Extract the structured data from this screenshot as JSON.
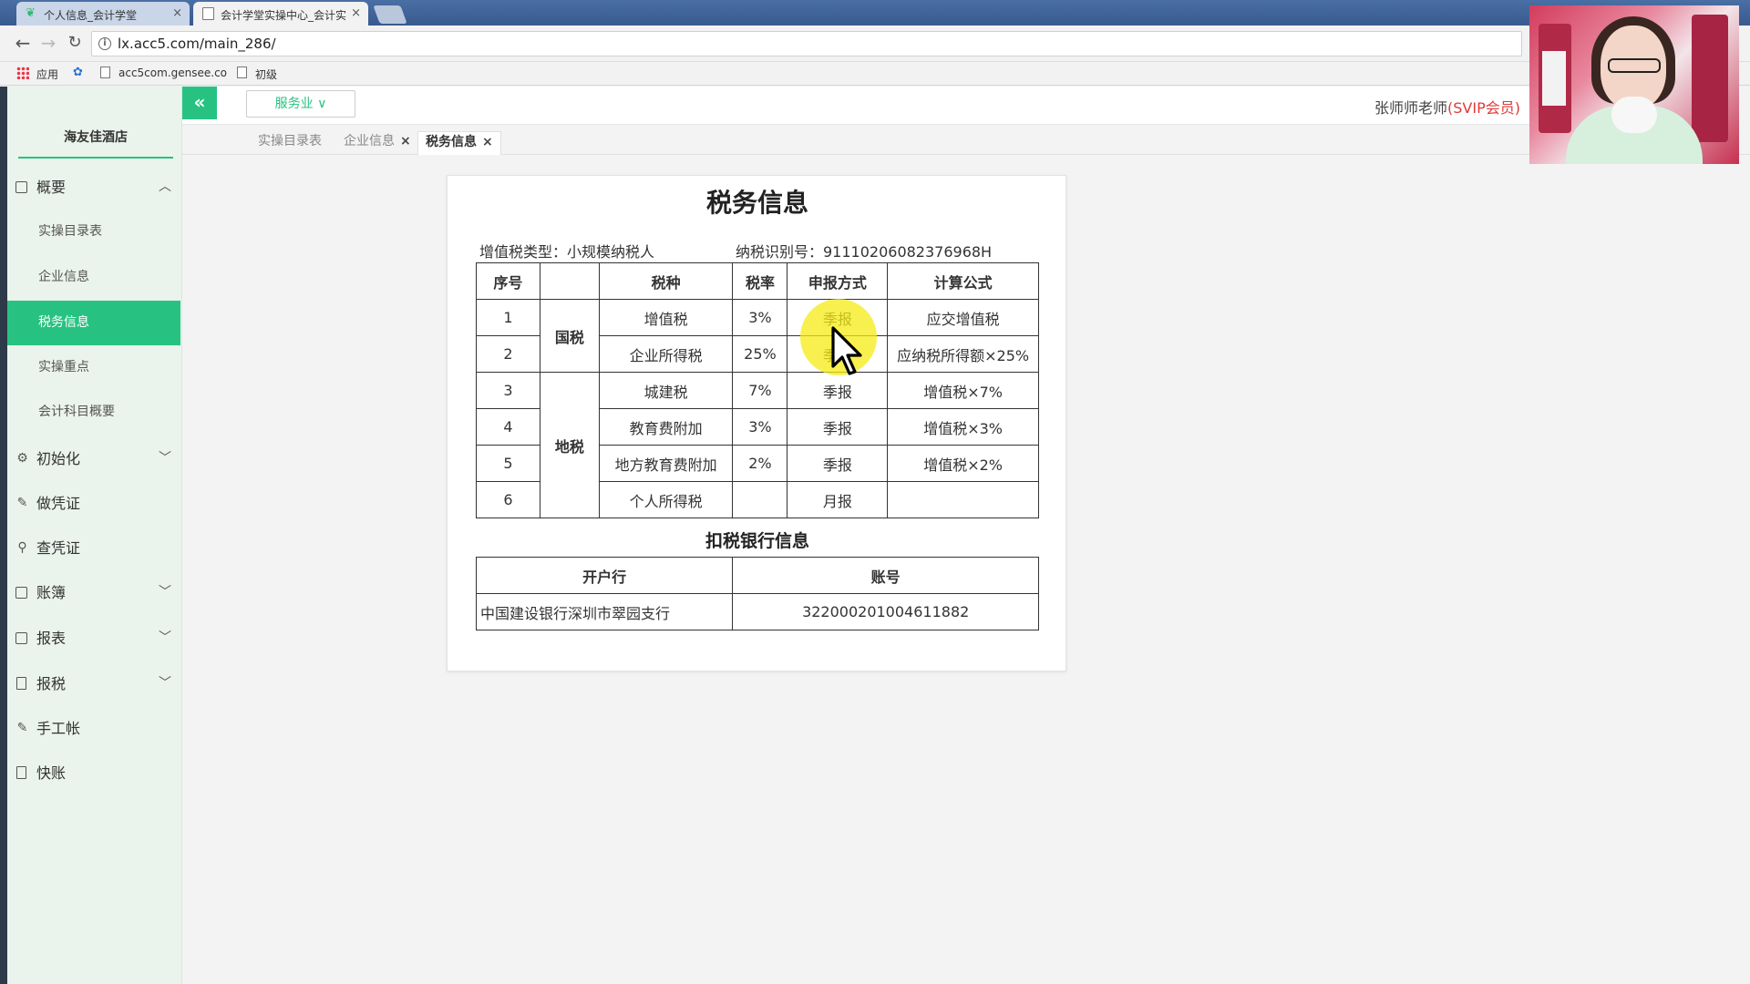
{
  "browser": {
    "tabs": [
      {
        "title": "个人信息_会计学堂",
        "close": "×"
      },
      {
        "title": "会计学堂实操中心_会计实",
        "close": "×"
      }
    ],
    "url": "lx.acc5.com/main_286/",
    "bookmarks": [
      {
        "label": "应用"
      },
      {
        "label": "acc5com.gensee.co"
      },
      {
        "label": "初级"
      }
    ]
  },
  "sidebar": {
    "company": "海友佳酒店",
    "overview": {
      "label": "概要",
      "icon": "grid-icon"
    },
    "sub_items": [
      {
        "label": "实操目录表"
      },
      {
        "label": "企业信息"
      },
      {
        "label": "税务信息"
      },
      {
        "label": "实操重点"
      },
      {
        "label": "会计科目概要"
      }
    ],
    "items": [
      {
        "label": "初始化",
        "icon": "gear-icon"
      },
      {
        "label": "做凭证",
        "icon": "pen-icon"
      },
      {
        "label": "查凭证",
        "icon": "search-icon"
      },
      {
        "label": "账簿",
        "icon": "book-icon"
      },
      {
        "label": "报表",
        "icon": "report-icon"
      },
      {
        "label": "报税",
        "icon": "file-icon"
      },
      {
        "label": "手工帐",
        "icon": "pen-icon"
      },
      {
        "label": "快账",
        "icon": "file-icon"
      }
    ]
  },
  "header": {
    "industry": "服务业",
    "user_name": "张师师老师",
    "user_level": "(SVIP会员)"
  },
  "page_tabs": [
    {
      "label": "实操目录表"
    },
    {
      "label": "企业信息",
      "close": "×"
    },
    {
      "label": "税务信息",
      "close": "×"
    }
  ],
  "tax_info": {
    "title": "税务信息",
    "vat_type": "增值税类型：小规模纳税人",
    "taxpayer_id": "纳税识别号：91110206082376968H",
    "headers": [
      "序号",
      "",
      "税种",
      "税率",
      "申报方式",
      "计算公式"
    ],
    "groups": [
      "国税",
      "地税"
    ],
    "rows": [
      {
        "no": "1",
        "tax": "增值税",
        "rate": "3%",
        "method": "季报",
        "formula": "应交增值税"
      },
      {
        "no": "2",
        "tax": "企业所得税",
        "rate": "25%",
        "method": "季报",
        "formula": "应纳税所得额×25%"
      },
      {
        "no": "3",
        "tax": "城建税",
        "rate": "7%",
        "method": "季报",
        "formula": "增值税×7%"
      },
      {
        "no": "4",
        "tax": "教育费附加",
        "rate": "3%",
        "method": "季报",
        "formula": "增值税×3%"
      },
      {
        "no": "5",
        "tax": "地方教育费附加",
        "rate": "2%",
        "method": "季报",
        "formula": "增值税×2%"
      },
      {
        "no": "6",
        "tax": "个人所得税",
        "rate": "",
        "method": "月报",
        "formula": ""
      }
    ],
    "bank_title": "扣税银行信息",
    "bank_headers": [
      "开户行",
      "账号"
    ],
    "bank_row": {
      "bank": "中国建设银行深圳市翠园支行",
      "account": "322000201004611882"
    }
  },
  "colors": {
    "accent": "#27c281",
    "svip": "#e03a3a"
  }
}
